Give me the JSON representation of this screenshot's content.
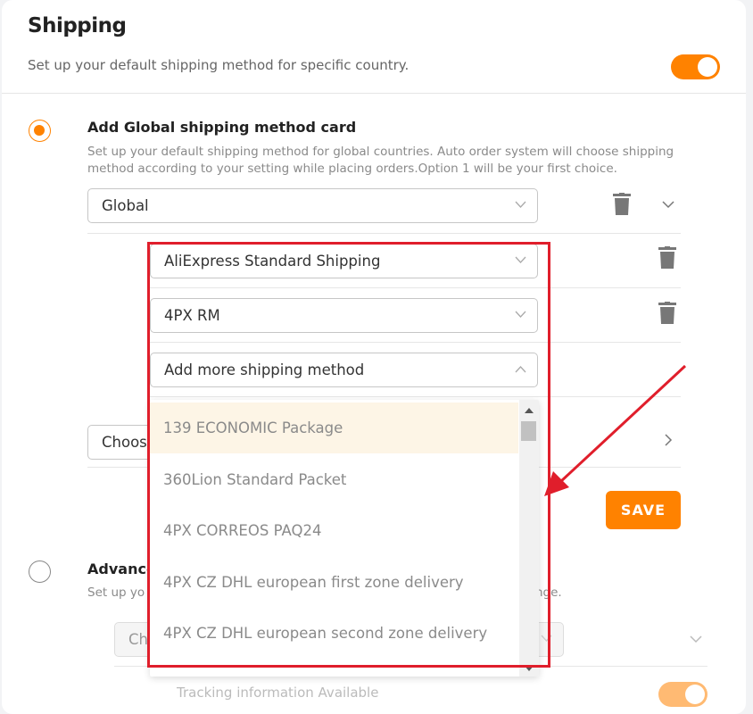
{
  "header": {
    "title": "Shipping",
    "subtitle": "Set up your default shipping method for specific country."
  },
  "global_option": {
    "title": "Add Global shipping method card",
    "description_line1": "Set up your default shipping method for global countries. Auto order system will choose shipping",
    "description_line2": "method according to your setting while placing orders.Option 1 will be your first choice.",
    "country_select": "Global",
    "methods": [
      "AliExpress Standard Shipping",
      "4PX RM"
    ],
    "add_more_label": "Add more shipping method",
    "choose_label": "Choos"
  },
  "dropdown": {
    "options": [
      "139 ECONOMIC Package",
      "360Lion Standard Packet",
      "4PX CORREOS PAQ24",
      "4PX CZ DHL european first zone delivery",
      "4PX CZ DHL european second zone delivery"
    ]
  },
  "save_label": "SAVE",
  "advanced_option": {
    "title": "Advance",
    "description_start": "Set up yo",
    "description_end": "nge.",
    "choose_label": "Ch",
    "tracking_label": "Tracking information Available"
  },
  "colors": {
    "accent": "#ff8200",
    "highlight_box": "#e01e2b"
  }
}
